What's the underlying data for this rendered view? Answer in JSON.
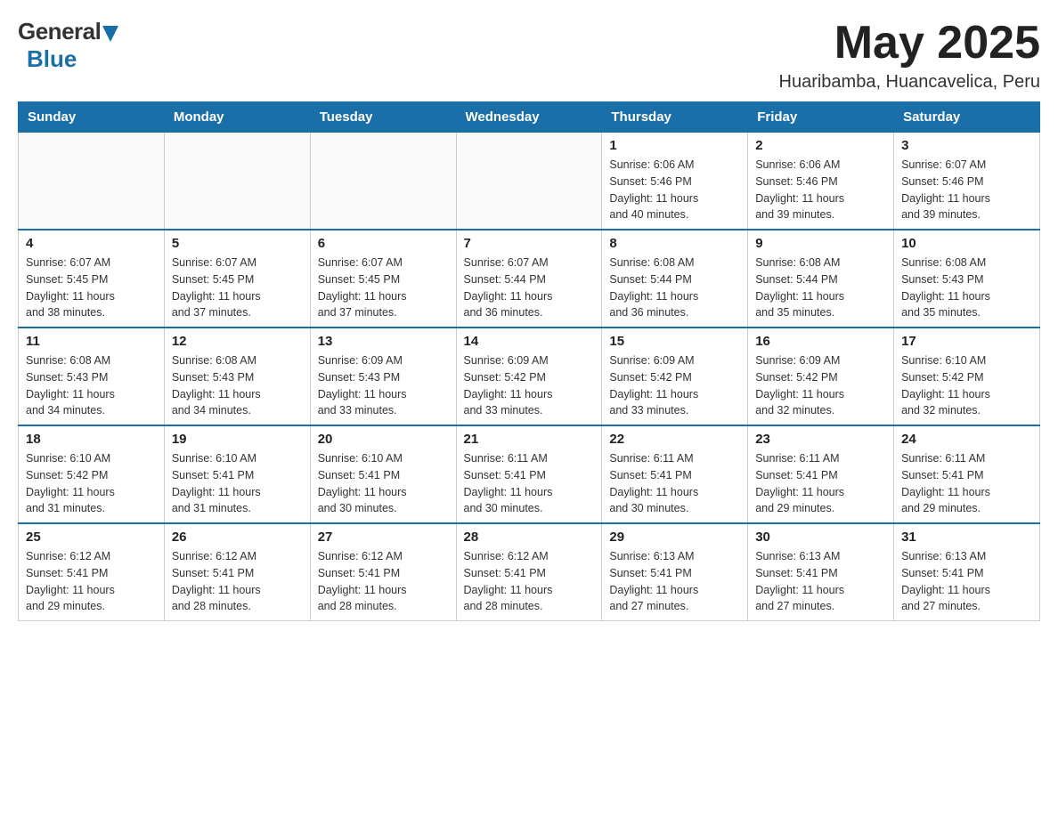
{
  "header": {
    "logo": {
      "general": "General",
      "blue": "Blue"
    },
    "month_title": "May 2025",
    "location": "Huaribamba, Huancavelica, Peru"
  },
  "days_of_week": [
    "Sunday",
    "Monday",
    "Tuesday",
    "Wednesday",
    "Thursday",
    "Friday",
    "Saturday"
  ],
  "weeks": [
    [
      {
        "day": "",
        "info": ""
      },
      {
        "day": "",
        "info": ""
      },
      {
        "day": "",
        "info": ""
      },
      {
        "day": "",
        "info": ""
      },
      {
        "day": "1",
        "info": "Sunrise: 6:06 AM\nSunset: 5:46 PM\nDaylight: 11 hours\nand 40 minutes."
      },
      {
        "day": "2",
        "info": "Sunrise: 6:06 AM\nSunset: 5:46 PM\nDaylight: 11 hours\nand 39 minutes."
      },
      {
        "day": "3",
        "info": "Sunrise: 6:07 AM\nSunset: 5:46 PM\nDaylight: 11 hours\nand 39 minutes."
      }
    ],
    [
      {
        "day": "4",
        "info": "Sunrise: 6:07 AM\nSunset: 5:45 PM\nDaylight: 11 hours\nand 38 minutes."
      },
      {
        "day": "5",
        "info": "Sunrise: 6:07 AM\nSunset: 5:45 PM\nDaylight: 11 hours\nand 37 minutes."
      },
      {
        "day": "6",
        "info": "Sunrise: 6:07 AM\nSunset: 5:45 PM\nDaylight: 11 hours\nand 37 minutes."
      },
      {
        "day": "7",
        "info": "Sunrise: 6:07 AM\nSunset: 5:44 PM\nDaylight: 11 hours\nand 36 minutes."
      },
      {
        "day": "8",
        "info": "Sunrise: 6:08 AM\nSunset: 5:44 PM\nDaylight: 11 hours\nand 36 minutes."
      },
      {
        "day": "9",
        "info": "Sunrise: 6:08 AM\nSunset: 5:44 PM\nDaylight: 11 hours\nand 35 minutes."
      },
      {
        "day": "10",
        "info": "Sunrise: 6:08 AM\nSunset: 5:43 PM\nDaylight: 11 hours\nand 35 minutes."
      }
    ],
    [
      {
        "day": "11",
        "info": "Sunrise: 6:08 AM\nSunset: 5:43 PM\nDaylight: 11 hours\nand 34 minutes."
      },
      {
        "day": "12",
        "info": "Sunrise: 6:08 AM\nSunset: 5:43 PM\nDaylight: 11 hours\nand 34 minutes."
      },
      {
        "day": "13",
        "info": "Sunrise: 6:09 AM\nSunset: 5:43 PM\nDaylight: 11 hours\nand 33 minutes."
      },
      {
        "day": "14",
        "info": "Sunrise: 6:09 AM\nSunset: 5:42 PM\nDaylight: 11 hours\nand 33 minutes."
      },
      {
        "day": "15",
        "info": "Sunrise: 6:09 AM\nSunset: 5:42 PM\nDaylight: 11 hours\nand 33 minutes."
      },
      {
        "day": "16",
        "info": "Sunrise: 6:09 AM\nSunset: 5:42 PM\nDaylight: 11 hours\nand 32 minutes."
      },
      {
        "day": "17",
        "info": "Sunrise: 6:10 AM\nSunset: 5:42 PM\nDaylight: 11 hours\nand 32 minutes."
      }
    ],
    [
      {
        "day": "18",
        "info": "Sunrise: 6:10 AM\nSunset: 5:42 PM\nDaylight: 11 hours\nand 31 minutes."
      },
      {
        "day": "19",
        "info": "Sunrise: 6:10 AM\nSunset: 5:41 PM\nDaylight: 11 hours\nand 31 minutes."
      },
      {
        "day": "20",
        "info": "Sunrise: 6:10 AM\nSunset: 5:41 PM\nDaylight: 11 hours\nand 30 minutes."
      },
      {
        "day": "21",
        "info": "Sunrise: 6:11 AM\nSunset: 5:41 PM\nDaylight: 11 hours\nand 30 minutes."
      },
      {
        "day": "22",
        "info": "Sunrise: 6:11 AM\nSunset: 5:41 PM\nDaylight: 11 hours\nand 30 minutes."
      },
      {
        "day": "23",
        "info": "Sunrise: 6:11 AM\nSunset: 5:41 PM\nDaylight: 11 hours\nand 29 minutes."
      },
      {
        "day": "24",
        "info": "Sunrise: 6:11 AM\nSunset: 5:41 PM\nDaylight: 11 hours\nand 29 minutes."
      }
    ],
    [
      {
        "day": "25",
        "info": "Sunrise: 6:12 AM\nSunset: 5:41 PM\nDaylight: 11 hours\nand 29 minutes."
      },
      {
        "day": "26",
        "info": "Sunrise: 6:12 AM\nSunset: 5:41 PM\nDaylight: 11 hours\nand 28 minutes."
      },
      {
        "day": "27",
        "info": "Sunrise: 6:12 AM\nSunset: 5:41 PM\nDaylight: 11 hours\nand 28 minutes."
      },
      {
        "day": "28",
        "info": "Sunrise: 6:12 AM\nSunset: 5:41 PM\nDaylight: 11 hours\nand 28 minutes."
      },
      {
        "day": "29",
        "info": "Sunrise: 6:13 AM\nSunset: 5:41 PM\nDaylight: 11 hours\nand 27 minutes."
      },
      {
        "day": "30",
        "info": "Sunrise: 6:13 AM\nSunset: 5:41 PM\nDaylight: 11 hours\nand 27 minutes."
      },
      {
        "day": "31",
        "info": "Sunrise: 6:13 AM\nSunset: 5:41 PM\nDaylight: 11 hours\nand 27 minutes."
      }
    ]
  ]
}
